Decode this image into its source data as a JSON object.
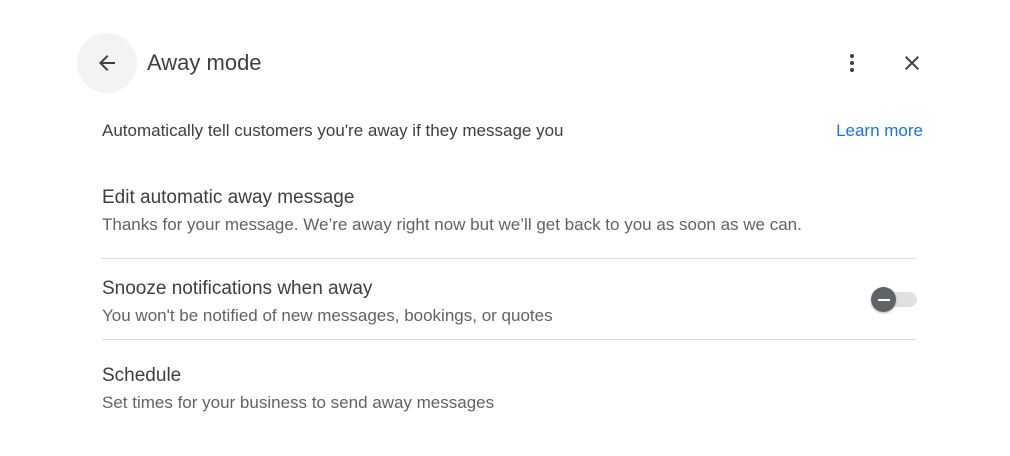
{
  "header": {
    "title": "Away mode",
    "back_icon": "arrow-back-icon",
    "more_icon": "more-vert-icon",
    "close_icon": "close-icon"
  },
  "intro": {
    "description": "Automatically tell customers you're away if they message you",
    "learn_more": "Learn more"
  },
  "settings": [
    {
      "title": "Edit automatic away message",
      "subtitle": "Thanks for your message. We’re away right now but we’ll get back to you as soon as we can."
    },
    {
      "title": "Snooze notifications when away",
      "subtitle": "You won't be notified of new messages, bookings, or quotes",
      "toggle_on": false
    },
    {
      "title": "Schedule",
      "subtitle": "Set times for your business to send away messages"
    }
  ],
  "colors": {
    "accent": "#1a73e8",
    "text_primary": "#3c4043",
    "text_secondary": "#5f6368",
    "divider": "#dadce0"
  }
}
